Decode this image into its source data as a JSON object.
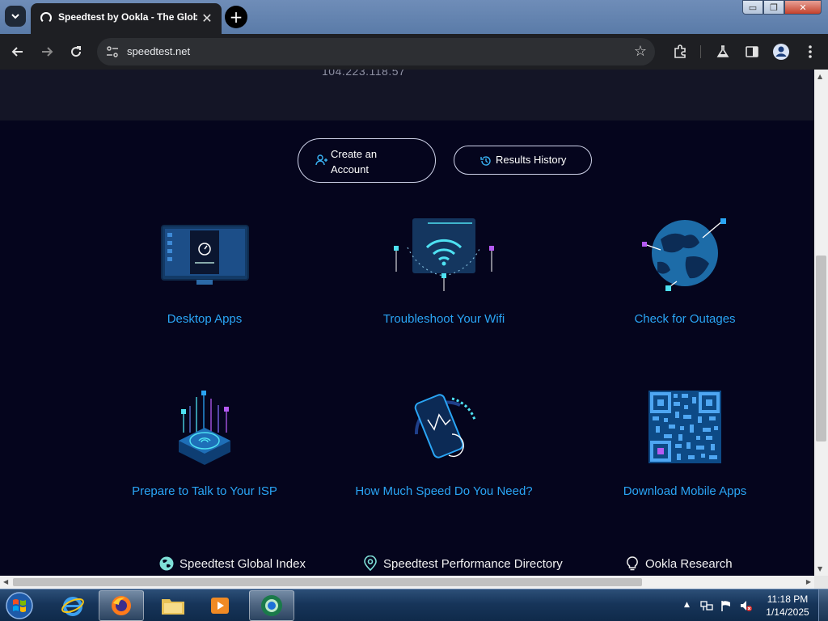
{
  "browser": {
    "tab_title": "Speedtest by Ookla - The Glob",
    "url": "speedtest.net",
    "window_controls": {
      "minimize": "▭",
      "maximize": "❐",
      "close": "✕"
    }
  },
  "page": {
    "ip_address": "104.223.118.57",
    "buttons": {
      "create_account_line1": "Create an",
      "create_account_line2": "Account",
      "results_history": "Results History"
    },
    "features": [
      {
        "label": "Desktop Apps",
        "icon": "desktop-monitor-icon"
      },
      {
        "label": "Troubleshoot Your Wifi",
        "icon": "wifi-icon"
      },
      {
        "label": "Check for Outages",
        "icon": "globe-icon"
      },
      {
        "label": "Prepare to Talk to Your ISP",
        "icon": "router-icon"
      },
      {
        "label": "How Much Speed Do You Need?",
        "icon": "phone-speed-icon"
      },
      {
        "label": "Download Mobile Apps",
        "icon": "qr-code-icon"
      }
    ],
    "bottom_links": [
      {
        "label": "Speedtest Global Index",
        "icon": "globe-icon"
      },
      {
        "label": "Speedtest Performance Directory",
        "icon": "location-pin-icon"
      },
      {
        "label": "Ookla Research",
        "icon": "lightbulb-icon"
      }
    ],
    "colors": {
      "background": "#05051d",
      "band": "#141526",
      "accent": "#2aa5f5",
      "cyan": "#4ee1f2",
      "purple": "#b45af2"
    }
  },
  "taskbar": {
    "apps": [
      "internet-explorer",
      "firefox",
      "file-explorer",
      "media-player",
      "chrome"
    ],
    "clock_time": "11:18 PM",
    "clock_date": "1/14/2025"
  }
}
